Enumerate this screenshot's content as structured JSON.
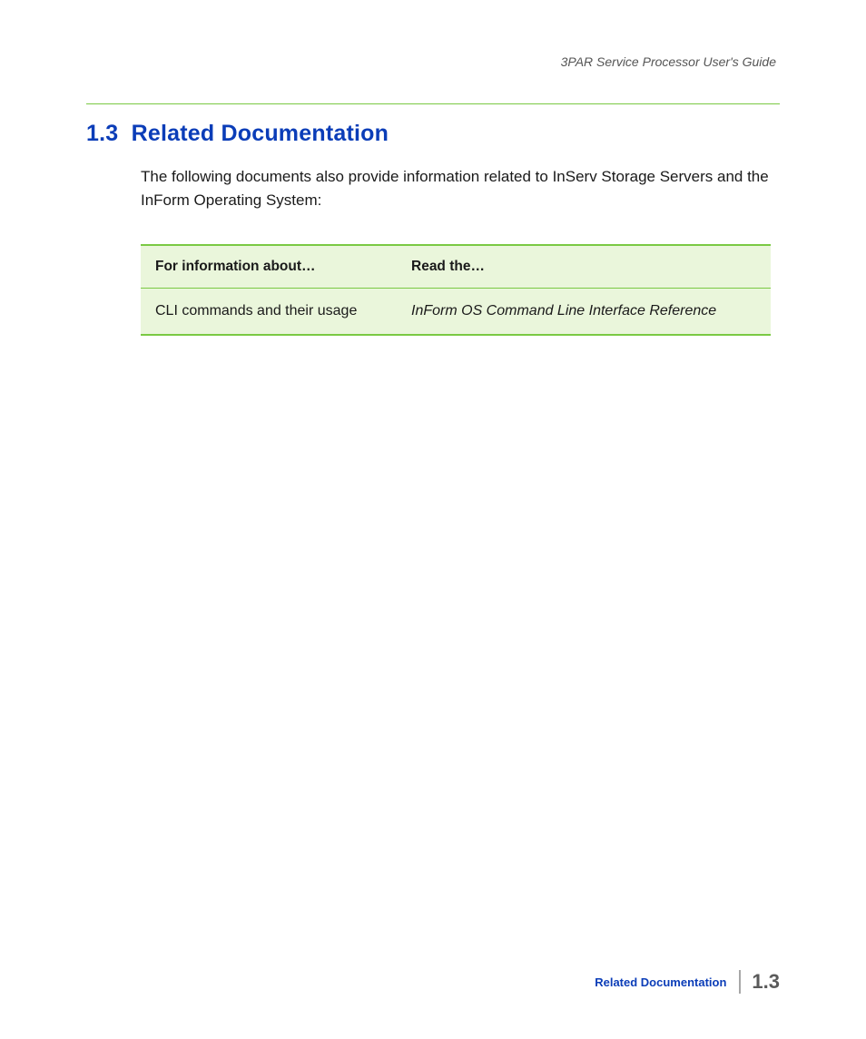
{
  "header": {
    "doc_title": "3PAR Service Processor User's Guide"
  },
  "section": {
    "number": "1.3",
    "title": "Related Documentation",
    "intro": "The following documents also provide information related to InServ Storage Servers and the InForm Operating System:"
  },
  "table": {
    "header_col1": "For information about…",
    "header_col2": "Read the…",
    "rows": [
      {
        "about": "CLI commands and their usage",
        "read": "InForm OS Command Line Interface Reference"
      }
    ]
  },
  "footer": {
    "label": "Related Documentation",
    "page_number": "1.3"
  }
}
